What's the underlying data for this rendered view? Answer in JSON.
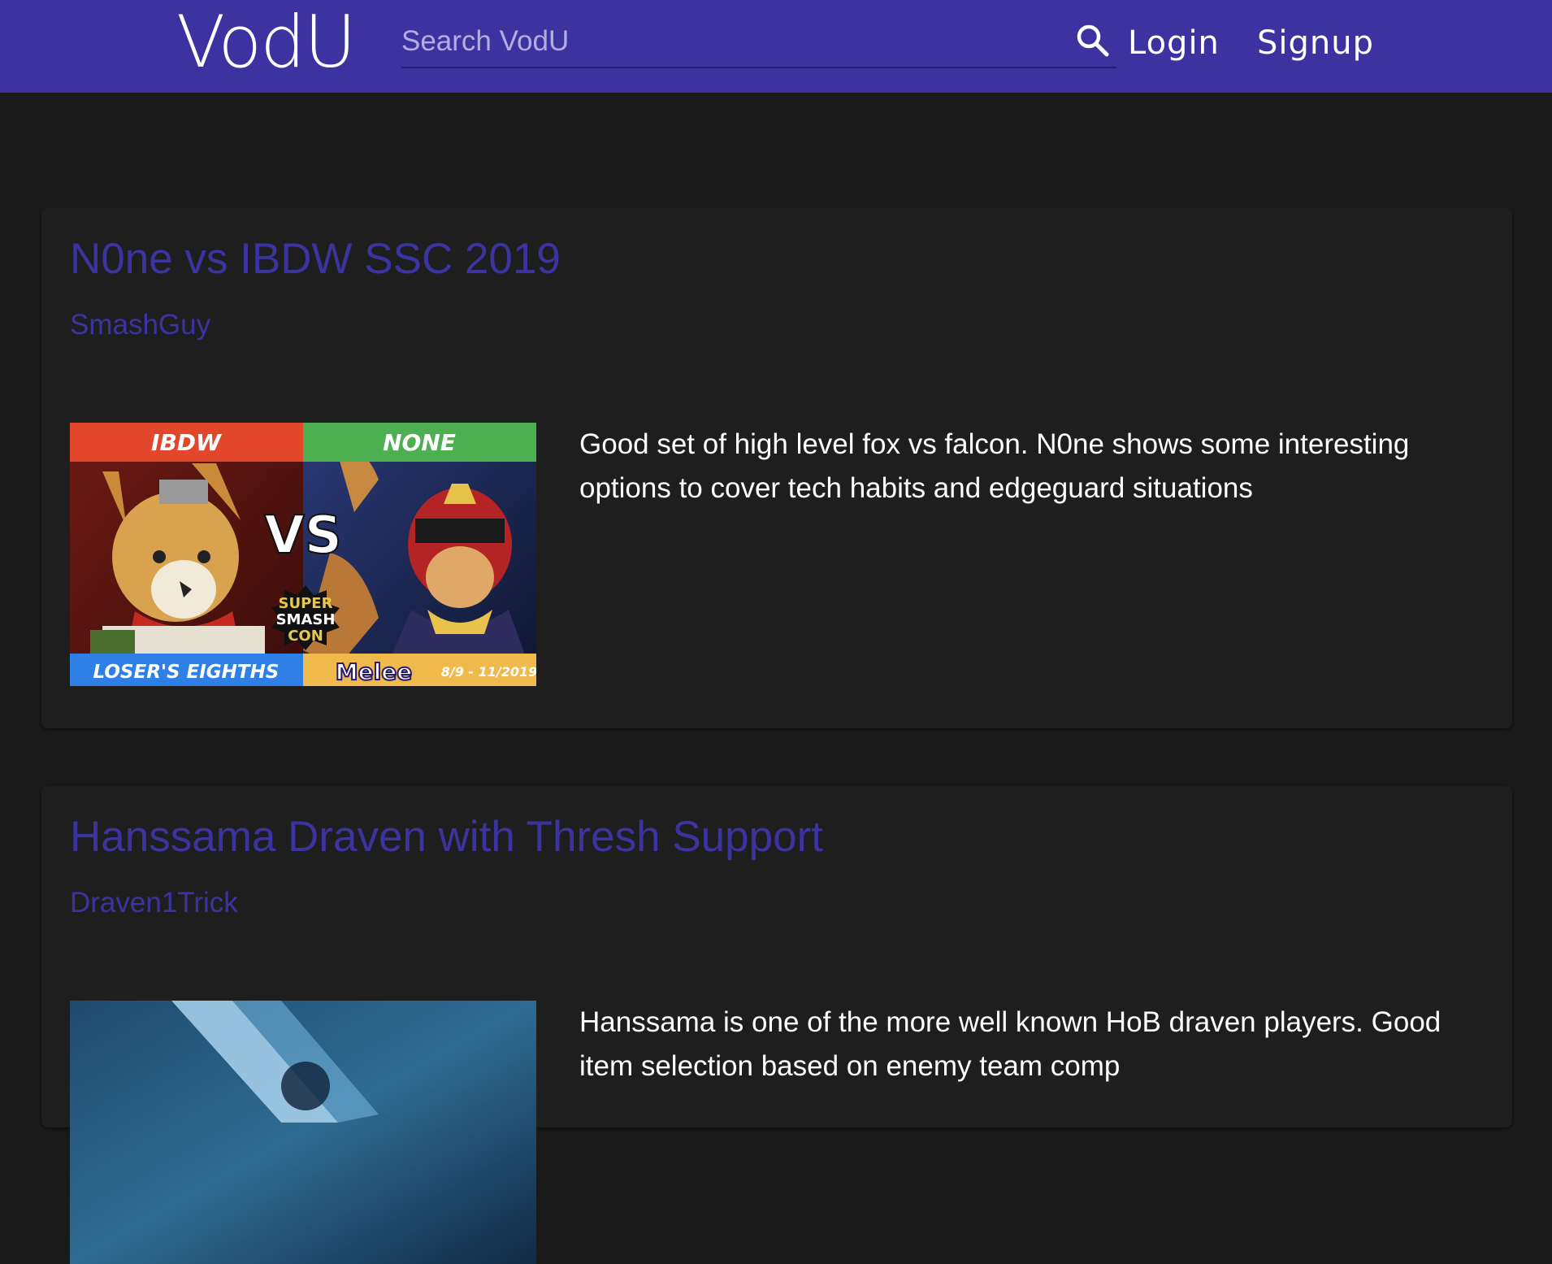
{
  "header": {
    "logo": "VodU",
    "search_placeholder": "Search VodU",
    "login": "Login",
    "signup": "Signup"
  },
  "vods": [
    {
      "title": "N0ne vs IBDW SSC 2019",
      "author": "SmashGuy",
      "description": "Good set of high level fox vs falcon. N0ne shows some interesting options to cover tech habits and edgeguard situations",
      "thumbnail": {
        "left_player": "IBDW",
        "right_player": "NONE",
        "vs": "VS",
        "round": "LOSER'S EIGHTHS",
        "game": "Melee",
        "dates": "8/9 - 11/2019",
        "logo_lines": [
          "SUPER",
          "SMASH",
          "CON"
        ]
      }
    },
    {
      "title": "Hanssama Draven with Thresh Support",
      "author": "Draven1Trick",
      "description": "Hanssama is one of the more well known HoB draven players. Good item selection based on enemy team comp"
    }
  ],
  "colors": {
    "accent": "#3d33a0",
    "background": "#1a1a1a",
    "card": "#1e1e1e"
  }
}
